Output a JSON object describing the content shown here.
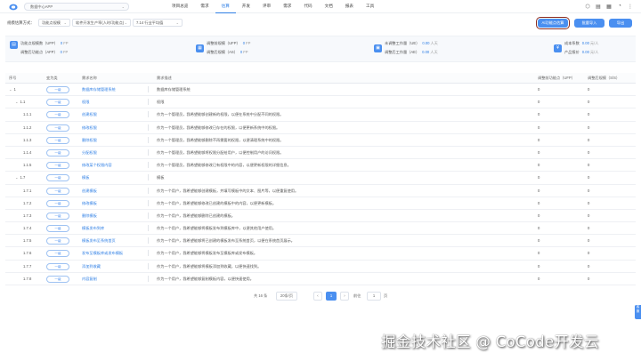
{
  "topbar": {
    "project_select": "数据中心APP",
    "menu": [
      {
        "label": "项目总览",
        "active": false
      },
      {
        "label": "需求",
        "active": false
      },
      {
        "label": "估算",
        "active": true
      },
      {
        "label": "开发",
        "active": false
      },
      {
        "label": "评审",
        "active": false
      },
      {
        "label": "需求",
        "active": false
      },
      {
        "label": "代码",
        "active": false
      },
      {
        "label": "文档",
        "active": false
      },
      {
        "label": "报表",
        "active": false
      },
      {
        "label": "工具",
        "active": false
      }
    ],
    "icons": [
      "cube-icon",
      "document-icon",
      "grid-icon",
      "user-icon",
      "more-icon"
    ]
  },
  "toolbar": {
    "scale_label": "规模估算方式：",
    "scale_value": "功能点规模",
    "dev_value": "软件开发生产率(人时/功能点)",
    "industry_value": "7.14  行业平均值",
    "ai_button": "AI功能点估算",
    "import_button": "批量导入",
    "export_button": "导出"
  },
  "summary": {
    "items": [
      {
        "label": "功能点规模数（UFP）",
        "value": "0",
        "unit": "FP"
      },
      {
        "label": "调整后功能点（AFP）",
        "value": "0",
        "unit": "FP"
      },
      {
        "label": "调整前规模（UFP）",
        "value": "0",
        "unit": "FP"
      },
      {
        "label": "调整后规模（AS）",
        "value": "0",
        "unit": "FP"
      },
      {
        "label": "未调整工作量（UE）",
        "value": "0.00",
        "unit": "人天"
      },
      {
        "label": "调整后工作量（AE）",
        "value": "0.00",
        "unit": "人天"
      },
      {
        "label": "成本系数",
        "value": "0.00",
        "unit": "元/人"
      },
      {
        "label": "产品报价",
        "value": "0.00",
        "unit": "元/人"
      }
    ]
  },
  "table": {
    "headers": [
      "序号",
      "变为类",
      "需求名称",
      "需求描述",
      "调整前功能点（UFP）",
      "调整后规模（S/S）"
    ],
    "rows": [
      {
        "no": "1",
        "badge": "一级",
        "name": "数据库存储管理系统",
        "desc": "数据库存储管理系统",
        "ufp": "0",
        "ss": "0",
        "lvl": 0,
        "arrow": "⌄"
      },
      {
        "no": "1.1",
        "badge": "一级",
        "name": "权限",
        "desc": "权限",
        "ufp": "0",
        "ss": "0",
        "lvl": 1,
        "arrow": "⌄"
      },
      {
        "no": "1.1.1",
        "badge": "一级",
        "name": "创建权限",
        "desc": "作为一个管理员，我希望能够创建新的权限，以便在系统中分配不同的权限。",
        "ufp": "0",
        "ss": "0",
        "lvl": 2,
        "arrow": ""
      },
      {
        "no": "1.1.2",
        "badge": "一级",
        "name": "修改权限",
        "desc": "作为一个管理员，我希望能够修改已存在的权限，以便更新系统中的权限。",
        "ufp": "0",
        "ss": "0",
        "lvl": 2,
        "arrow": ""
      },
      {
        "no": "1.1.3",
        "badge": "一级",
        "name": "删除权限",
        "desc": "作为一个管理员，我希望能够删除不再需要的权限，以便清理系统中的权限。",
        "ufp": "0",
        "ss": "0",
        "lvl": 2,
        "arrow": ""
      },
      {
        "no": "1.1.4",
        "badge": "一级",
        "name": "分配权限",
        "desc": "作为一个管理员，我希望能够将权限分配给用户，以便控制用户的访问权限。",
        "ufp": "0",
        "ss": "0",
        "lvl": 2,
        "arrow": ""
      },
      {
        "no": "1.1.5",
        "badge": "一级",
        "name": "修改某个权限内容",
        "desc": "作为一个管理员，我希望能够修改已有权限中的内容，以便更新权限的详细信息。",
        "ufp": "0",
        "ss": "0",
        "lvl": 2,
        "arrow": ""
      },
      {
        "no": "1.7",
        "badge": "一级",
        "name": "模板",
        "desc": "模板",
        "ufp": "0",
        "ss": "0",
        "lvl": 1,
        "arrow": "⌄"
      },
      {
        "no": "1.7.1",
        "badge": "一级",
        "name": "创建模板",
        "desc": "作为一个用户，我希望能够创建模板，并填写模板中的文本、图片等，以便重复使用。",
        "ufp": "0",
        "ss": "0",
        "lvl": 2,
        "arrow": ""
      },
      {
        "no": "1.7.2",
        "badge": "一级",
        "name": "修改模板",
        "desc": "作为一个用户，我希望能够修改已创建的模板中的内容，以便更新模板。",
        "ufp": "0",
        "ss": "0",
        "lvl": 2,
        "arrow": ""
      },
      {
        "no": "1.7.3",
        "badge": "一级",
        "name": "删除模板",
        "desc": "作为一个用户，我希望能够删除已创建的模板。",
        "ufp": "0",
        "ss": "0",
        "lvl": 2,
        "arrow": ""
      },
      {
        "no": "1.7.4",
        "badge": "一级",
        "name": "模板发布到库",
        "desc": "作为一个用户，我希望能够将模板发布到模板库中，以便其他用户使用。",
        "ufp": "0",
        "ss": "0",
        "lvl": 2,
        "arrow": ""
      },
      {
        "no": "1.7.5",
        "badge": "一级",
        "name": "模板发布至系统首页",
        "desc": "作为一个用户，我希望能够将已创建的模板发布至系统首页，以便在系统首页展示。",
        "ufp": "0",
        "ss": "0",
        "lvl": 2,
        "arrow": ""
      },
      {
        "no": "1.7.6",
        "badge": "一级",
        "name": "发布至模板库或发布模板",
        "desc": "作为一个用户，我希望能够将模板发布至模板库或发布模板。",
        "ufp": "0",
        "ss": "0",
        "lvl": 2,
        "arrow": ""
      },
      {
        "no": "1.7.7",
        "badge": "一级",
        "name": "添加到收藏",
        "desc": "作为一个用户，我希望能够将模板添加到收藏，以便快速找到。",
        "ufp": "0",
        "ss": "0",
        "lvl": 2,
        "arrow": ""
      },
      {
        "no": "1.7.8",
        "badge": "一级",
        "name": "内容复制",
        "desc": "作为一个用户，我希望能够复制模板内容，以便快速使用。",
        "ufp": "0",
        "ss": "0",
        "lvl": 2,
        "arrow": ""
      }
    ]
  },
  "pager": {
    "total": "共 16 条",
    "page_size": "20条/页",
    "prev": "‹",
    "current": "1",
    "next": "›",
    "goto_label": "前往",
    "goto_value": "1",
    "page_suffix": "页"
  },
  "side_tab": "客服",
  "watermark": "掘金技术社区 @ CoCode开发云"
}
